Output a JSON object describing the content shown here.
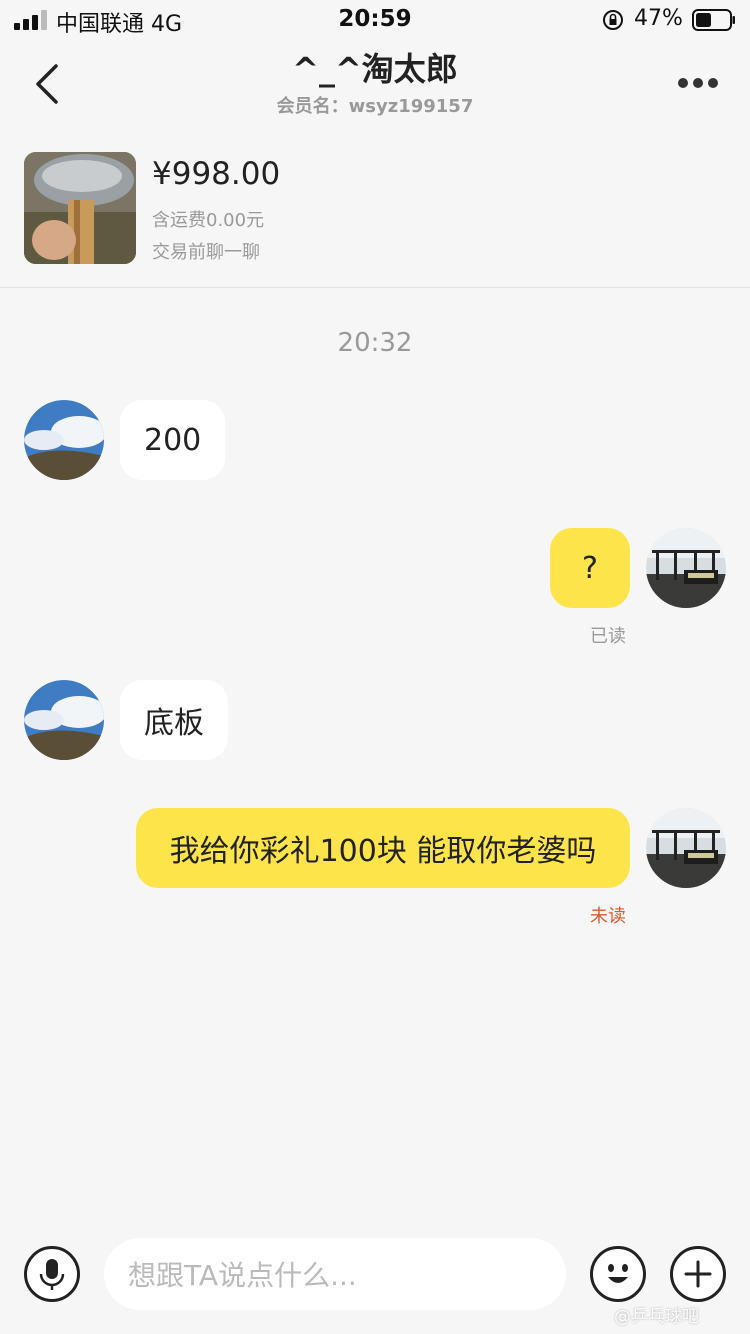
{
  "status_bar": {
    "carrier": "中国联通  4G",
    "time": "20:59",
    "battery_pct": "47%",
    "battery_level": 0.47
  },
  "nav": {
    "title": "^_^淘太郎",
    "member": "会员名：wsyz199157"
  },
  "product": {
    "price": "¥998.00",
    "shipping": "含运费0.00元",
    "hint": "交易前聊一聊"
  },
  "chat": {
    "timestamp": "20:32",
    "messages": [
      {
        "side": "in",
        "text": "200"
      },
      {
        "side": "out",
        "text": "?",
        "status": "已读"
      },
      {
        "side": "in",
        "text": "底板"
      },
      {
        "side": "out",
        "text": "我给你彩礼100块 能取你老婆吗",
        "status": "未读"
      }
    ]
  },
  "input": {
    "placeholder": "想跟TA说点什么..."
  },
  "watermark": "@乒乓球吧",
  "colors": {
    "outgoing_bubble": "#fde44a",
    "incoming_bubble": "#ffffff",
    "read": "#999999",
    "unread": "#e0592a",
    "background": "#f6f6f6"
  }
}
